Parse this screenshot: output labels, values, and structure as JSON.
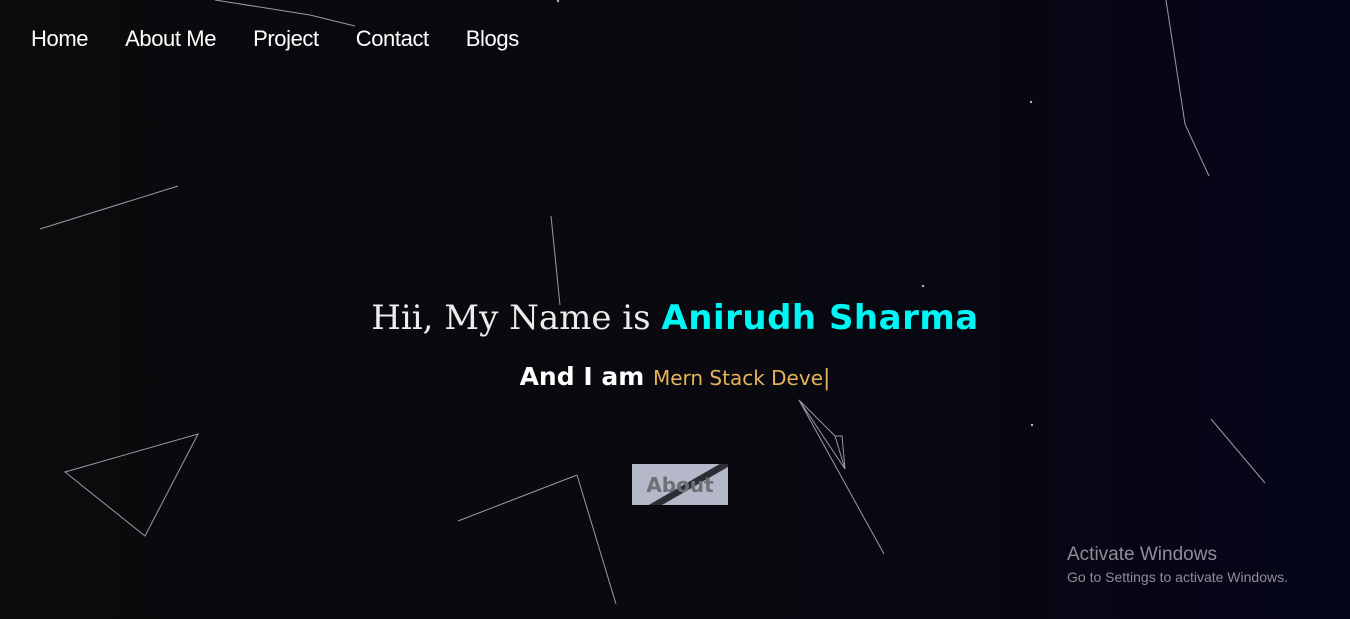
{
  "nav": {
    "items": [
      {
        "label": "Home"
      },
      {
        "label": "About Me"
      },
      {
        "label": "Project"
      },
      {
        "label": "Contact"
      },
      {
        "label": "Blogs"
      }
    ]
  },
  "hero": {
    "greeting_prefix": "Hii, My Name is ",
    "name": "Anirudh Sharma",
    "role_prefix": "And I am ",
    "typed_role": "Mern Stack Deve",
    "cursor": "|"
  },
  "about_button": {
    "label": "About"
  },
  "watermark": {
    "title": "Activate Windows",
    "subtitle": "Go to Settings to activate Windows."
  },
  "colors": {
    "name": "#00f5f5",
    "role": "#e6b25c",
    "text": "#ffffff",
    "background": "#0b0b0d"
  }
}
